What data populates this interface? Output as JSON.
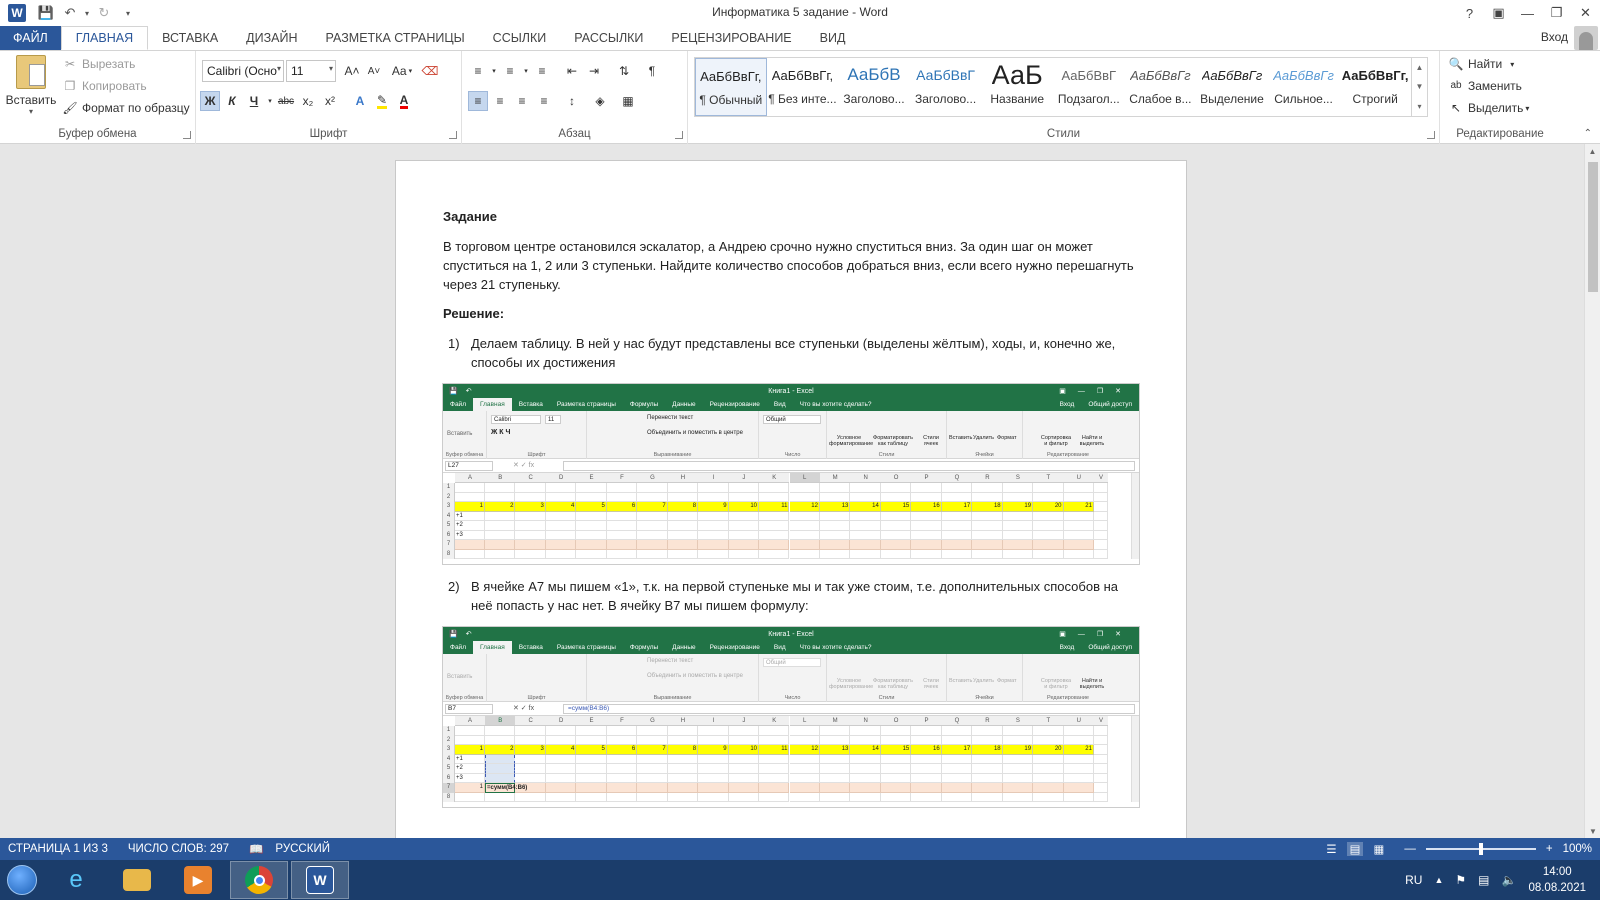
{
  "window": {
    "title": "Информатика 5 задание - Word",
    "account": "Вход"
  },
  "tabs": [
    {
      "label": "ФАЙЛ"
    },
    {
      "label": "ГЛАВНАЯ"
    },
    {
      "label": "ВСТАВКА"
    },
    {
      "label": "ДИЗАЙН"
    },
    {
      "label": "РАЗМЕТКА СТРАНИЦЫ"
    },
    {
      "label": "ССЫЛКИ"
    },
    {
      "label": "РАССЫЛКИ"
    },
    {
      "label": "РЕЦЕНЗИРОВАНИЕ"
    },
    {
      "label": "ВИД"
    }
  ],
  "ribbon": {
    "clipboard": {
      "label": "Буфер обмена",
      "paste": "Вставить",
      "cut": "Вырезать",
      "copy": "Копировать",
      "format_painter": "Формат по образцу"
    },
    "font": {
      "label": "Шрифт",
      "font_name": "Calibri (Осно",
      "font_size": "11",
      "change_case": "Aa",
      "bold": "Ж",
      "italic": "К",
      "underline": "Ч",
      "strike": "abc",
      "sub": "x₂",
      "sup": "x²"
    },
    "paragraph": {
      "label": "Абзац"
    },
    "styles": {
      "label": "Стили",
      "items": [
        {
          "sample": "АаБбВвГг,",
          "name": "¶ Обычный"
        },
        {
          "sample": "АаБбВвГг,",
          "name": "¶ Без инте..."
        },
        {
          "sample": "АаБбВ",
          "name": "Заголово..."
        },
        {
          "sample": "АаБбВвГ",
          "name": "Заголово..."
        },
        {
          "sample": "АаБ",
          "name": "Название"
        },
        {
          "sample": "АаБбВвГ",
          "name": "Подзагол..."
        },
        {
          "sample": "АаБбВвГг",
          "name": "Слабое в..."
        },
        {
          "sample": "АаБбВвГг",
          "name": "Выделение"
        },
        {
          "sample": "АаБбВвГг",
          "name": "Сильное..."
        },
        {
          "sample": "АаБбВвГг,",
          "name": "Строгий"
        }
      ]
    },
    "editing": {
      "label": "Редактирование",
      "find": "Найти",
      "replace": "Заменить",
      "select": "Выделить"
    }
  },
  "document": {
    "heading1": "Задание",
    "task_text": "В торговом центре остановился эскалатор, а Андрею срочно нужно спуститься вниз. За один шаг он может спуститься на 1, 2 или 3 ступеньки. Найдите количество способов добраться вниз, если всего нужно перешагнуть через 21 ступеньку.",
    "heading2": "Решение:",
    "steps": [
      {
        "num": "1)",
        "text": "Делаем таблицу. В ней у нас будут представлены все ступеньки (выделены жёлтым), ходы, и, конечно же, способы их достижения"
      },
      {
        "num": "2)",
        "text": "В ячейке А7 мы пишем «1», т.к. на первой ступеньке мы и так уже стоим, т.е. дополнительных способов на неё попасть у нас нет. В ячейку В7 мы пишем формулу:"
      }
    ]
  },
  "excel1": {
    "title": "Книга1 - Excel",
    "namebox": "L27",
    "formula": "",
    "tabs": [
      "Файл",
      "Главная",
      "Вставка",
      "Разметка страницы",
      "Формулы",
      "Данные",
      "Рецензирование",
      "Вид",
      "Что вы хотите сделать?"
    ],
    "login": "Вход",
    "share": "Общий доступ",
    "font": "Calibri",
    "size": "11",
    "numfmt": "Общий",
    "wrap": "Перенести текст",
    "merge": "Объединить и поместить в центре",
    "cond": "Условное форматирование",
    "fmt_table": "Форматировать как таблицу",
    "cell_styles": "Стили ячеек",
    "insert": "Вставить",
    "delete": "Удалить",
    "format": "Формат",
    "sort": "Сортировка и фильтр",
    "find": "Найти и выделить",
    "paste": "Вставить",
    "groups": [
      "Буфер обмена",
      "Шрифт",
      "Выравнивание",
      "Число",
      "Стили",
      "Ячейки",
      "Редактирование"
    ],
    "extra_cells": {}
  },
  "excel2": {
    "title": "Книга1 - Excel",
    "namebox": "B7",
    "formula": "=сумм(B4:B6)",
    "a7": "1",
    "b7": "=сумм(B4:B6)"
  },
  "excel_grid": {
    "columns": [
      "A",
      "B",
      "C",
      "D",
      "E",
      "F",
      "G",
      "H",
      "I",
      "J",
      "K",
      "L",
      "M",
      "N",
      "O",
      "P",
      "Q",
      "R",
      "S",
      "T",
      "U",
      "V"
    ],
    "rows": [
      "1",
      "2",
      "3",
      "4",
      "5",
      "6",
      "7",
      "8"
    ],
    "steps": [
      "1",
      "2",
      "3",
      "4",
      "5",
      "6",
      "7",
      "8",
      "9",
      "10",
      "11",
      "12",
      "13",
      "14",
      "15",
      "16",
      "17",
      "18",
      "19",
      "20",
      "21"
    ],
    "moves": [
      "+1",
      "+2",
      "+3"
    ]
  },
  "status": {
    "page": "СТРАНИЦА 1 ИЗ 3",
    "words": "ЧИСЛО СЛОВ: 297",
    "lang": "РУССКИЙ",
    "zoom": "100%"
  },
  "taskbar": {
    "lang": "RU",
    "time": "14:00",
    "date": "08.08.2021"
  },
  "colors": {
    "word_blue": "#2b579a",
    "excel_green": "#217346",
    "step_yellow": "#ffff00",
    "ways_peach": "#fbe4d5"
  }
}
